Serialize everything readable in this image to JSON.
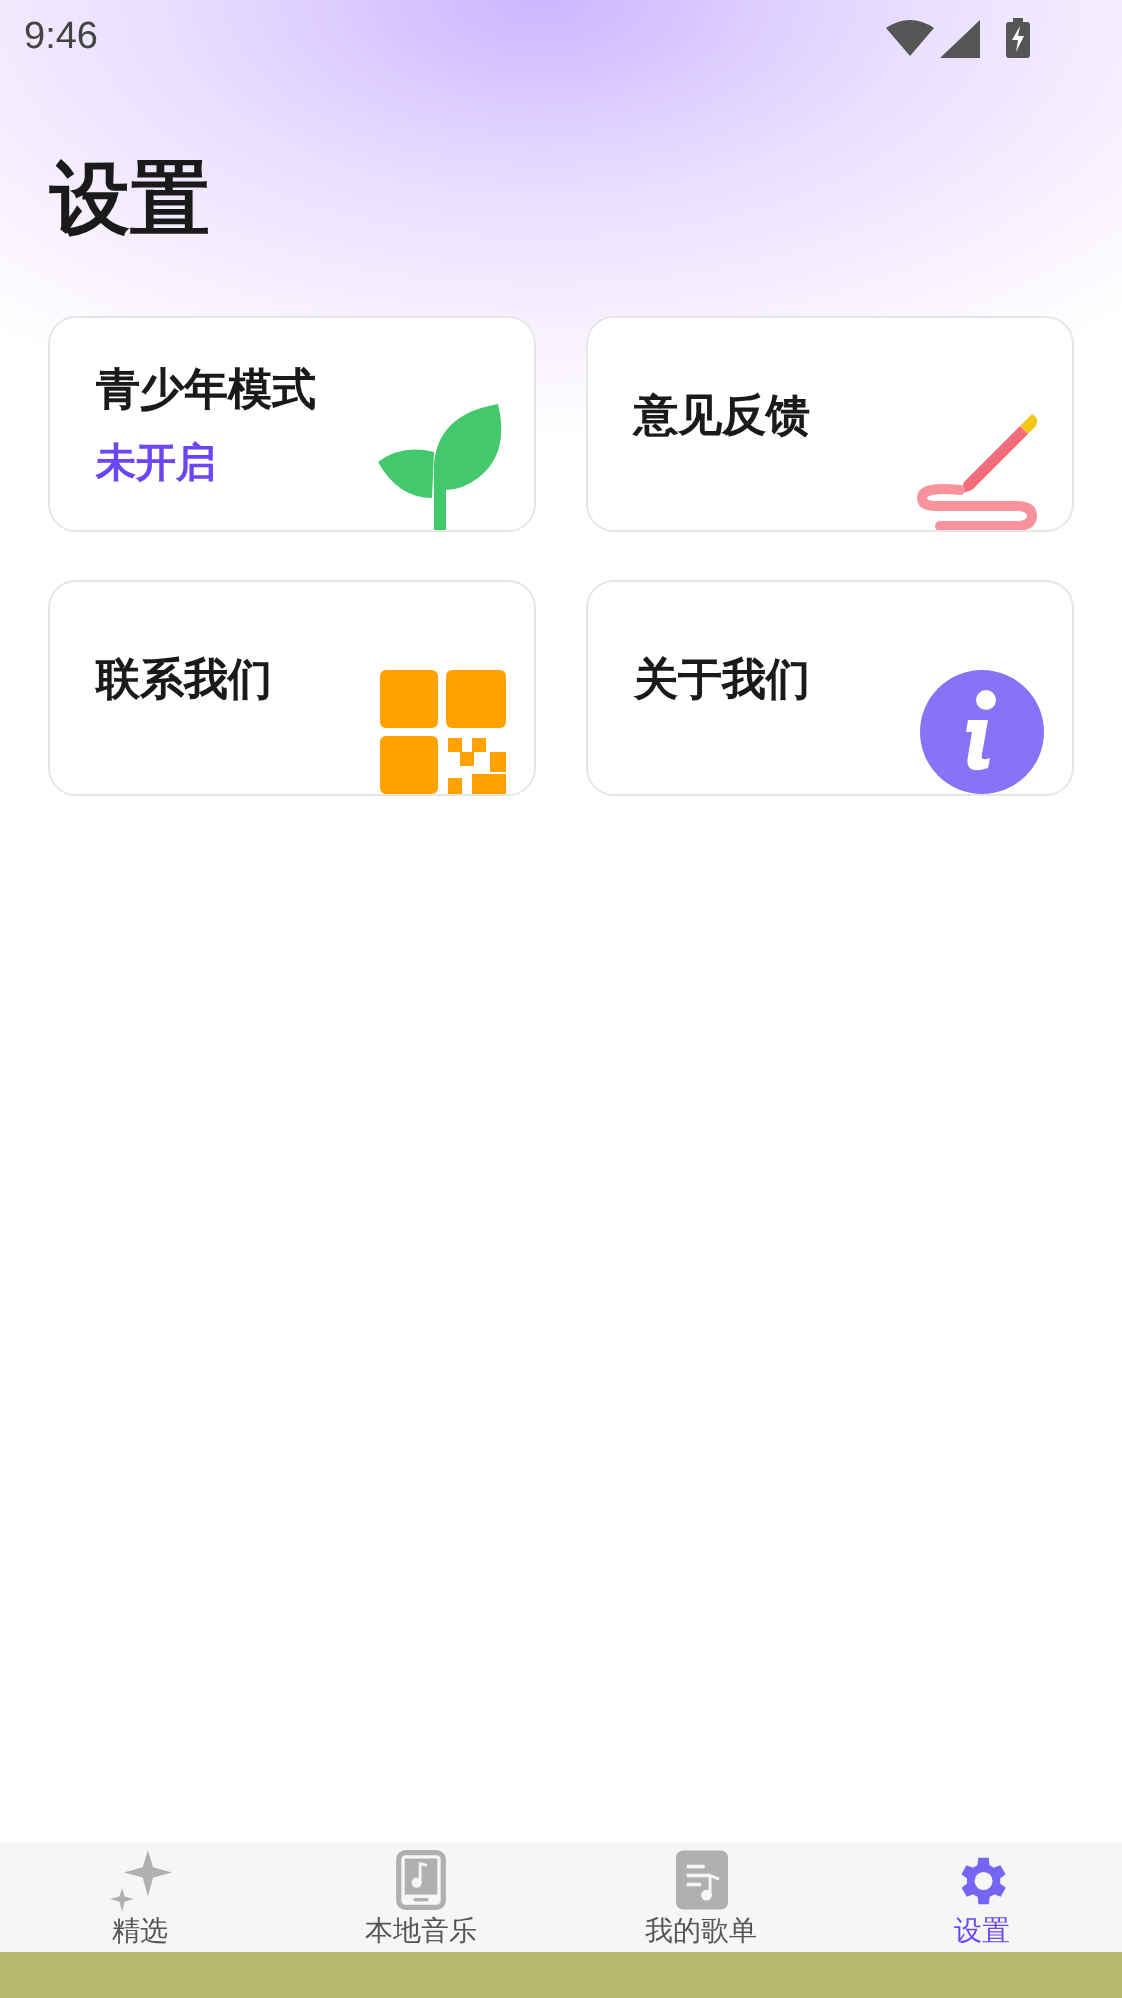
{
  "status_bar": {
    "time": "9:46"
  },
  "title": "设置",
  "cards": [
    {
      "title": "青少年模式",
      "subtitle": "未开启"
    },
    {
      "title": "意见反馈"
    },
    {
      "title": "联系我们"
    },
    {
      "title": "关于我们"
    }
  ],
  "nav": [
    {
      "label": "精选",
      "selected": false
    },
    {
      "label": "本地音乐",
      "selected": false
    },
    {
      "label": "我的歌单",
      "selected": false
    },
    {
      "label": "设置",
      "selected": true
    }
  ]
}
